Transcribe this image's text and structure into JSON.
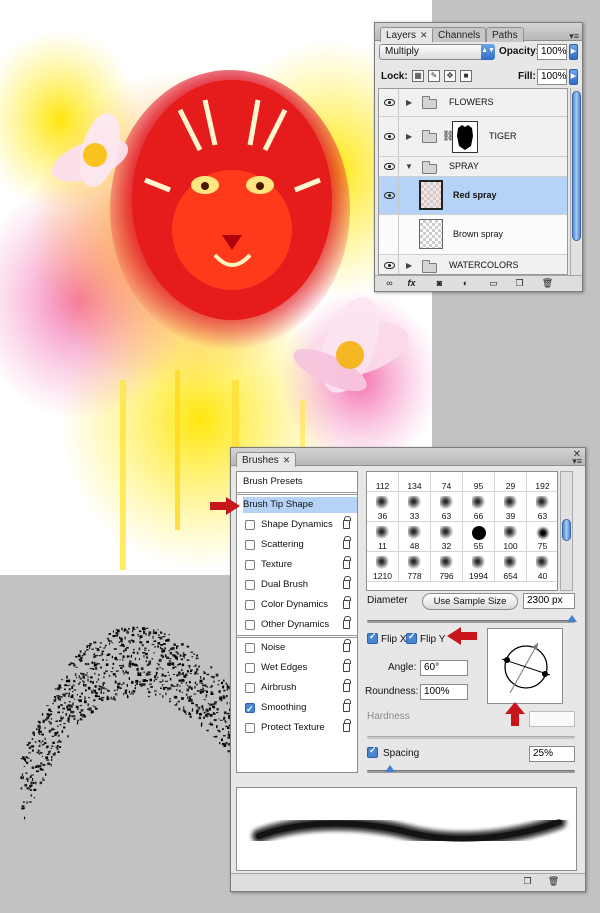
{
  "layers_panel": {
    "tabs": [
      {
        "label": "Layers",
        "active": true
      },
      {
        "label": "Channels",
        "active": false
      },
      {
        "label": "Paths",
        "active": false
      }
    ],
    "blend_mode": "Multiply",
    "opacity_label": "Opacity:",
    "opacity_value": "100%",
    "lock_label": "Lock:",
    "fill_label": "Fill:",
    "fill_value": "100%",
    "layers": [
      {
        "name": "FLOWERS",
        "type": "group",
        "expanded": false,
        "visible": true
      },
      {
        "name": "TIGER",
        "type": "group",
        "expanded": false,
        "visible": true,
        "has_mask": true
      },
      {
        "name": "SPRAY",
        "type": "group",
        "expanded": true,
        "visible": true
      },
      {
        "name": "Red spray",
        "type": "layer",
        "visible": true,
        "selected": true
      },
      {
        "name": "Brown spray",
        "type": "layer",
        "visible": false,
        "selected": false
      },
      {
        "name": "WATERCOLORS",
        "type": "group",
        "expanded": false,
        "visible": true
      }
    ],
    "footer_icons": [
      "link-icon",
      "fx-icon",
      "mask-icon",
      "adjustment-icon",
      "folder-icon",
      "new-layer-icon",
      "trash-icon"
    ]
  },
  "brushes_panel": {
    "tab_label": "Brushes",
    "presets_label": "Brush Presets",
    "tip_shape_label": "Brush Tip Shape",
    "options": [
      {
        "label": "Shape Dynamics",
        "checked": false
      },
      {
        "label": "Scattering",
        "checked": false
      },
      {
        "label": "Texture",
        "checked": false
      },
      {
        "label": "Dual Brush",
        "checked": false
      },
      {
        "label": "Color Dynamics",
        "checked": false
      },
      {
        "label": "Other Dynamics",
        "checked": false
      }
    ],
    "options2": [
      {
        "label": "Noise",
        "checked": false
      },
      {
        "label": "Wet Edges",
        "checked": false
      },
      {
        "label": "Airbrush",
        "checked": false
      },
      {
        "label": "Smoothing",
        "checked": true
      },
      {
        "label": "Protect Texture",
        "checked": false
      }
    ],
    "brush_grid": [
      [
        "112",
        "134",
        "74",
        "95",
        "29",
        "192"
      ],
      [
        "36",
        "33",
        "63",
        "66",
        "39",
        "63"
      ],
      [
        "11",
        "48",
        "32",
        "55",
        "100",
        "75"
      ],
      [
        "1210",
        "778",
        "796",
        "1994",
        "654",
        "40"
      ]
    ],
    "diameter_label": "Diameter",
    "sample_size_label": "Use Sample Size",
    "diameter_value": "2300 px",
    "flip_x_label": "Flip X",
    "flip_y_label": "Flip Y",
    "angle_label": "Angle:",
    "angle_value": "60°",
    "roundness_label": "Roundness:",
    "roundness_value": "100%",
    "hardness_label": "Hardness",
    "spacing_label": "Spacing",
    "spacing_value": "25%",
    "colors": {
      "accent": "#4a86d6",
      "selection": "#b4d3f6",
      "arrow": "#c8151b"
    }
  }
}
